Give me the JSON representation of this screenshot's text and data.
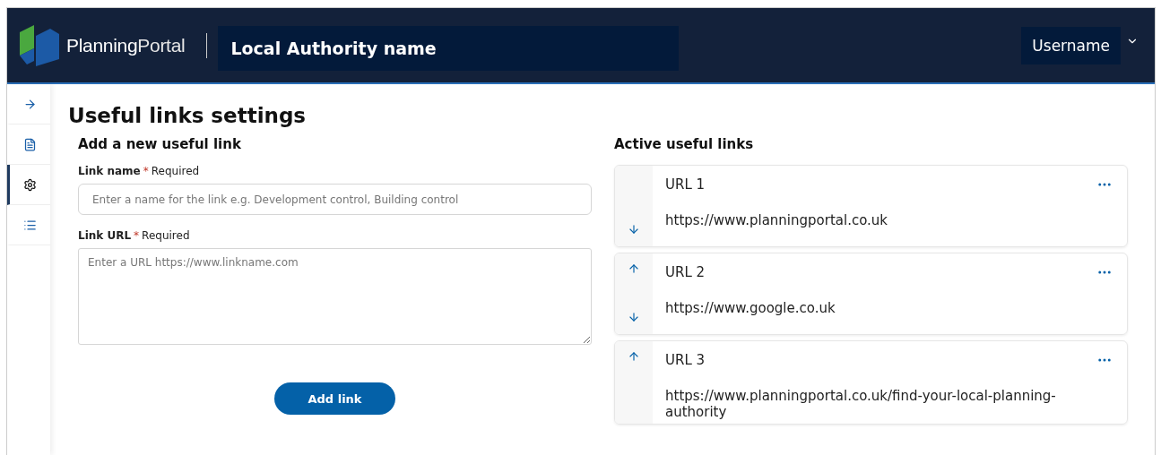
{
  "header": {
    "logo_text_bold": "Planning",
    "logo_text_light": "Portal",
    "authority": "Local Authority name",
    "user": "Username"
  },
  "sidebar": {
    "items": [
      {
        "kind": "arrow",
        "selected": false
      },
      {
        "kind": "document",
        "selected": false
      },
      {
        "kind": "settings",
        "selected": true
      },
      {
        "kind": "list",
        "selected": false
      }
    ]
  },
  "page_title": "Useful links settings",
  "form": {
    "heading": "Add a new useful link",
    "fields": [
      {
        "kind": "input",
        "label": "Link name",
        "required_mark": "*",
        "required_text": "Required",
        "placeholder": "Enter a name for the link e.g. Development control, Building control"
      },
      {
        "kind": "textarea",
        "label": "Link URL",
        "required_mark": "*",
        "required_text": "Required",
        "placeholder": "Enter a URL https://www.linkname.com"
      }
    ],
    "button": "Add link"
  },
  "active_links": {
    "heading": "Active useful links",
    "items": [
      {
        "name": "URL 1",
        "url": "https://www.planningportal.co.uk",
        "move_up": false,
        "move_down": true
      },
      {
        "name": "URL 2",
        "url": "https://www.google.co.uk",
        "move_up": true,
        "move_down": true
      },
      {
        "name": "URL 3",
        "url": "https://www.planningportal.co.uk/find-your-local-planning-authority",
        "move_up": true,
        "move_down": false
      }
    ]
  }
}
